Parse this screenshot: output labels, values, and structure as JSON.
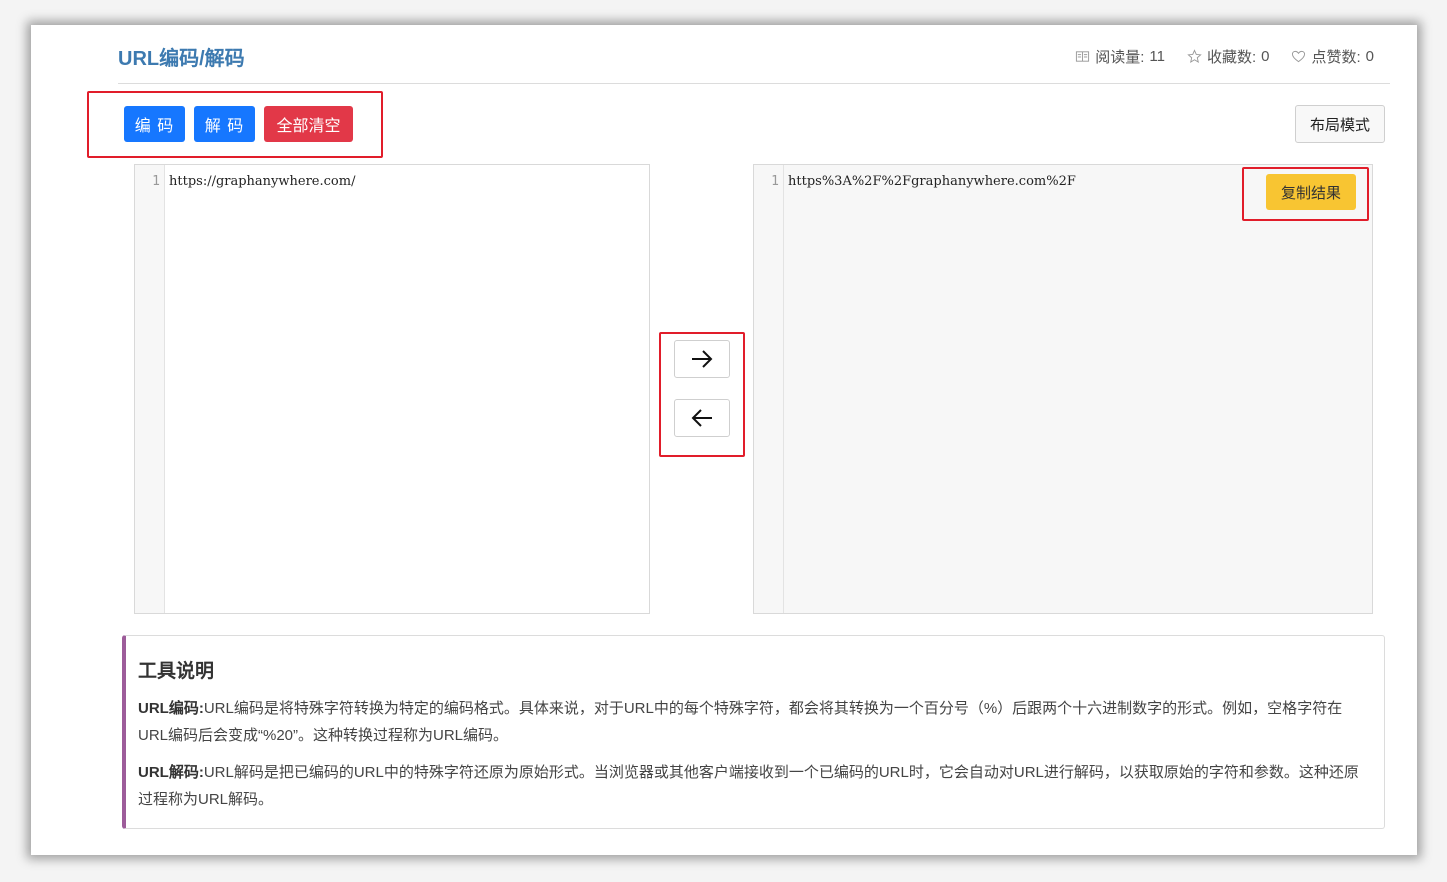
{
  "header": {
    "title": "URL编码/解码",
    "stats": [
      {
        "icon": "book-icon",
        "label": "阅读量:",
        "value": "11"
      },
      {
        "icon": "star-icon",
        "label": "收藏数:",
        "value": "0"
      },
      {
        "icon": "heart-icon",
        "label": "点赞数:",
        "value": "0"
      }
    ]
  },
  "toolbar": {
    "encode_label": "编 码",
    "decode_label": "解 码",
    "clear_label": "全部清空",
    "layout_label": "布局模式"
  },
  "input_editor": {
    "line_number": "1",
    "content": "https://graphanywhere.com/"
  },
  "output_editor": {
    "line_number": "1",
    "content": "https%3A%2F%2Fgraphanywhere.com%2F",
    "copy_label": "复制结果"
  },
  "arrows": {
    "encode_icon": "arrow-right-icon",
    "decode_icon": "arrow-left-icon"
  },
  "description": {
    "title": "工具说明",
    "items": [
      {
        "term": "URL编码:",
        "text": "URL编码是将特殊字符转换为特定的编码格式。具体来说，对于URL中的每个特殊字符，都会将其转换为一个百分号（%）后跟两个十六进制数字的形式。例如，空格字符在URL编码后会变成“%20”。这种转换过程称为URL编码。"
      },
      {
        "term": "URL解码:",
        "text": "URL解码是把已编码的URL中的特殊字符还原为原始形式。当浏览器或其他客户端接收到一个已编码的URL时，它会自动对URL进行解码，以获取原始的字符和参数。这种还原过程称为URL解码。"
      }
    ]
  },
  "colors": {
    "title": "#3d7ab0",
    "primary": "#1677ff",
    "danger": "#e23848",
    "warning": "#f8c532",
    "highlight": "#e11d2a",
    "accent_bar": "#9d5c9a"
  }
}
